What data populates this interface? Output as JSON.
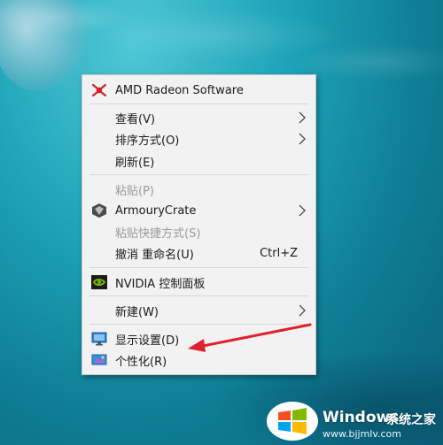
{
  "menu": {
    "items": [
      {
        "label": "AMD Radeon Software",
        "icon": "amd-radeon-icon"
      },
      {
        "label": "查看(V)",
        "submenu": true
      },
      {
        "label": "排序方式(O)",
        "submenu": true
      },
      {
        "label": "刷新(E)"
      },
      {
        "label": "粘贴(P)",
        "disabled": true
      },
      {
        "label": "ArmouryCrate",
        "icon": "armourycrate-icon",
        "submenu": true
      },
      {
        "label": "粘贴快捷方式(S)",
        "disabled": true
      },
      {
        "label": "撤消 重命名(U)",
        "shortcut": "Ctrl+Z"
      },
      {
        "label": "NVIDIA 控制面板",
        "icon": "nvidia-icon"
      },
      {
        "label": "新建(W)",
        "submenu": true
      },
      {
        "label": "显示设置(D)",
        "icon": "display-settings-icon"
      },
      {
        "label": "个性化(R)",
        "icon": "personalize-icon"
      }
    ]
  },
  "annotation": {
    "arrow_color": "#e0202a",
    "points_to": "显示设置(D)"
  },
  "watermark": {
    "brand_main": "Windows",
    "brand_cn": "系统之家",
    "url": "www.bjjmlv.com"
  }
}
